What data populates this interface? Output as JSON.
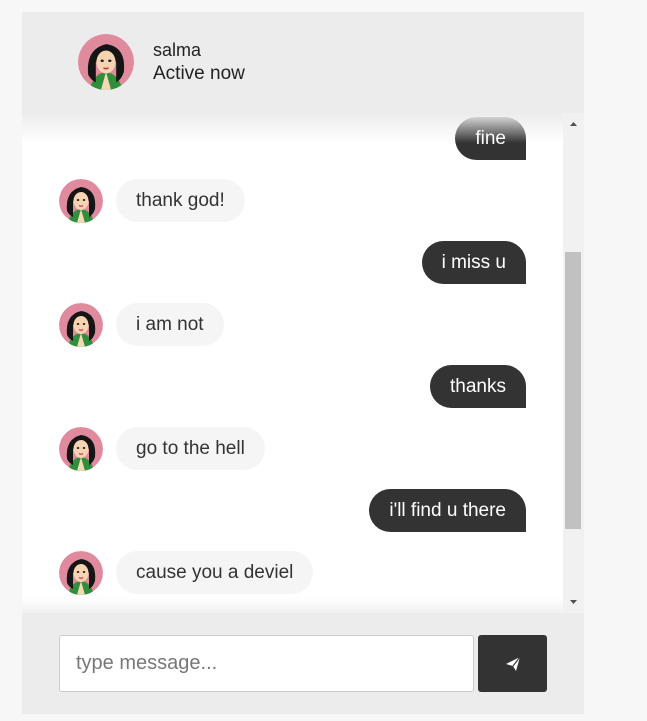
{
  "header": {
    "name": "salma",
    "status": "Active now",
    "avatar_icon": "woman-avatar-icon"
  },
  "messages": [
    {
      "direction": "out",
      "text": "fine"
    },
    {
      "direction": "in",
      "text": "thank god!"
    },
    {
      "direction": "out",
      "text": "i miss u"
    },
    {
      "direction": "in",
      "text": "i am not"
    },
    {
      "direction": "out",
      "text": "thanks"
    },
    {
      "direction": "in",
      "text": "go to the hell"
    },
    {
      "direction": "out",
      "text": "i'll find u there"
    },
    {
      "direction": "in",
      "text": "cause you a deviel"
    }
  ],
  "composer": {
    "placeholder": "type message...",
    "value": "",
    "send_icon": "paper-plane-icon"
  },
  "colors": {
    "outgoing_bubble": "#333333",
    "incoming_bubble": "#f5f5f5",
    "panel": "#ececec"
  }
}
